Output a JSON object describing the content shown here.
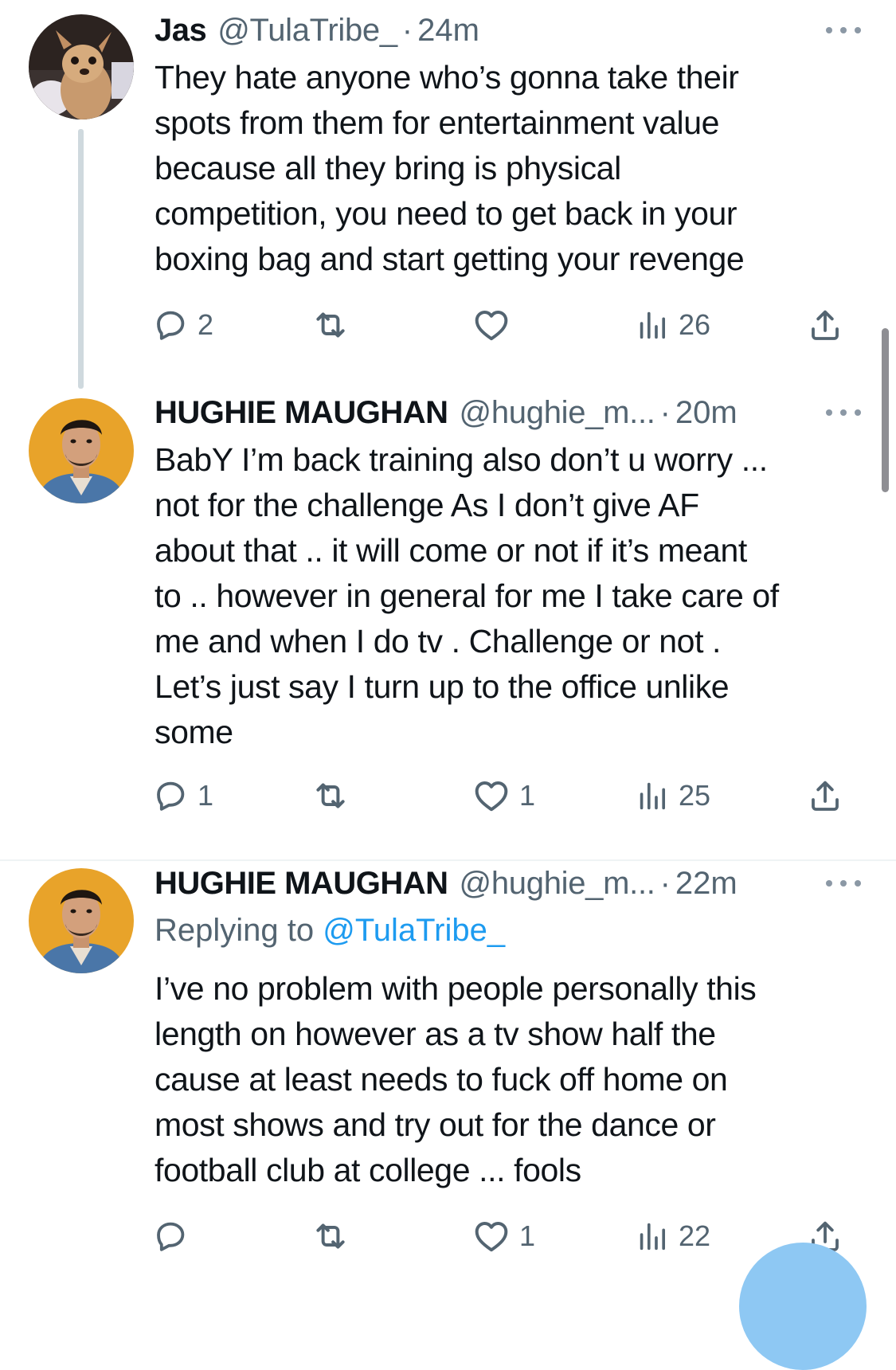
{
  "tweets": [
    {
      "name": "Jas",
      "handle": "@TulaTribe_",
      "separator": "·",
      "time": "24m",
      "body_lines": [
        "They hate anyone who’s gonna take their",
        "spots from them for entertainment value",
        "because all they bring is physical",
        "competition, you need to get back in your",
        "boxing bag and start getting your revenge"
      ],
      "replies": "2",
      "retweets": "",
      "likes": "",
      "views": "26"
    },
    {
      "name": "HUGHIE MAUGHAN",
      "handle": "@hughie_m...",
      "separator": "·",
      "time": "20m",
      "body_lines": [
        "BabY I’m back training also don’t u worry ...",
        "not for the challenge As I don’t give AF",
        "about that .. it will come or not if it’s meant",
        "to .. however in general for me I take care of",
        "me and when I do tv . Challenge or not .",
        "Let’s just say I turn up to the office unlike",
        "some"
      ],
      "replies": "1",
      "retweets": "",
      "likes": "1",
      "views": "25"
    },
    {
      "name": "HUGHIE MAUGHAN",
      "handle": "@hughie_m...",
      "separator": "·",
      "time": "22m",
      "replying_prefix": "Replying to",
      "replying_to": "@TulaTribe_",
      "body_lines": [
        "I’ve no problem with people personally this",
        "length on however as a tv show half the",
        "cause at least needs to fuck off home on",
        "most shows and try out for the dance or",
        "football club at college ... fools"
      ],
      "replies": "",
      "retweets": "",
      "likes": "1",
      "views": "22"
    }
  ],
  "icons": {
    "reply": "reply-icon",
    "retweet": "retweet-icon",
    "like": "heart-icon",
    "views": "views-icon",
    "share": "share-icon",
    "more": "more-icon"
  },
  "colors": {
    "text": "#0f1419",
    "secondary": "#536471",
    "link": "#1d9bf0",
    "thread_line": "#cfd9de",
    "fab": "#8ec8f3"
  }
}
